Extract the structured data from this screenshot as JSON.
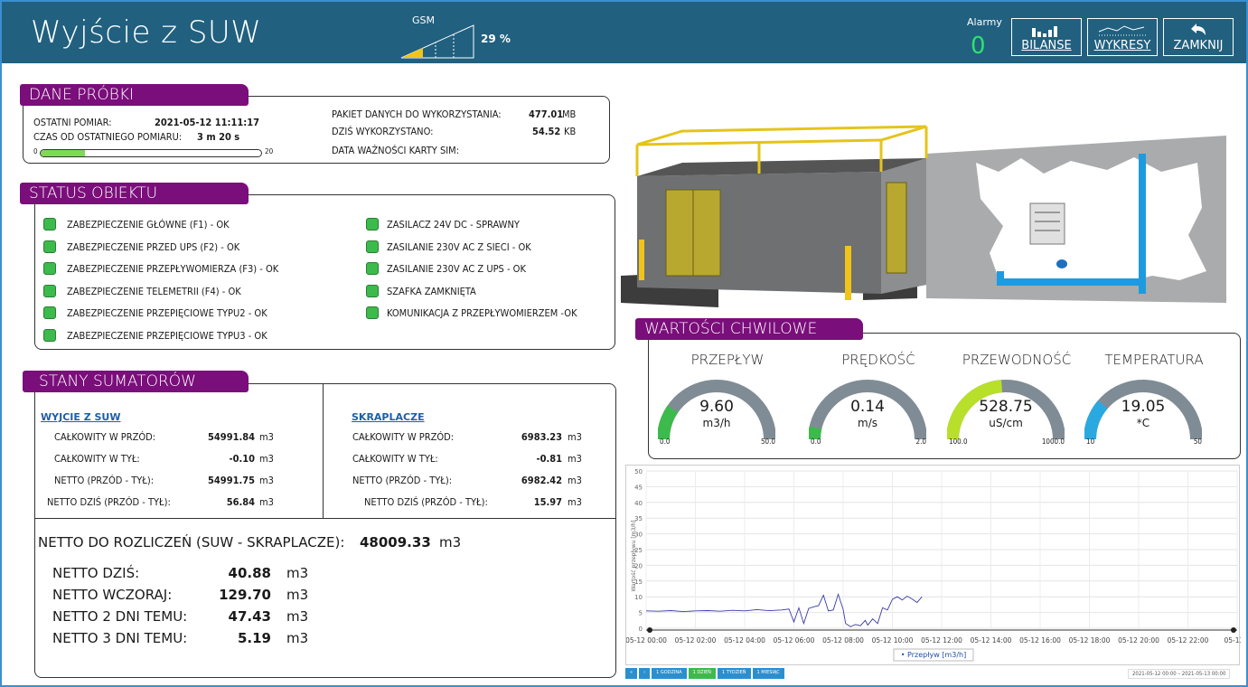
{
  "header": {
    "title": "Wyjście z SUW",
    "gsm_label": "GSM",
    "gsm_percent": "29 %",
    "gsm_level": 0.29,
    "alarm_label": "Alarmy",
    "alarm_count": "0",
    "buttons": {
      "bilanse": "BILANSE",
      "wykresy": "WYKRESY",
      "zamknij": "ZAMKNIJ"
    }
  },
  "dane_probki": {
    "title": "DANE PRÓBKI",
    "ostatni_label": "OSTATNI POMIAR:",
    "ostatni_value": "2021-05-12 11:11:17",
    "czas_label": "CZAS OD OSTATNIEGO POMIARU:",
    "czas_value": "3 m 20 s",
    "progress_min": "0",
    "progress_max": "20",
    "progress_fraction": 0.2,
    "pakiet_label": "PAKIET DANYCH DO WYKORZYSTANIA:",
    "pakiet_value": "477.01",
    "pakiet_unit": "MB",
    "dzis_label": "DZIŚ WYKORZYSTANO:",
    "dzis_value": "54.52",
    "dzis_unit": "KB",
    "sim_label": "DATA WAŻNOŚCI KARTY SIM:"
  },
  "status": {
    "title": "STATUS OBIEKTU",
    "left": [
      "ZABEZPIECZENIE GŁÓWNE (F1) - OK",
      "ZABEZPIECZENIE PRZED UPS (F2) - OK",
      "ZABEZPIECZENIE PRZEPŁYWOMIERZA (F3) - OK",
      "ZABEZPIECZENIE TELEMETRII (F4) - OK",
      "ZABEZPIECZENIE PRZEPIĘCIOWE TYPU2 - OK",
      "ZABEZPIECZENIE PRZEPIĘCIOWE TYPU3 - OK"
    ],
    "right": [
      "ZASILACZ 24V DC - SPRAWNY",
      "ZASILANIE 230V AC Z SIECI - OK",
      "ZASILANIE 230V AC Z UPS - OK",
      "SZAFKA ZAMKNIĘTA",
      "KOMUNIKACJA Z PRZEPŁYWOMIERZEM -OK"
    ]
  },
  "sumatory": {
    "title": "STANY SUMATORÓW",
    "suw_title": "WYJCIE Z SUW",
    "skr_title": "SKRAPLACZE",
    "rows_labels": [
      "CAŁKOWITY W PRZÓD:",
      "CAŁKOWITY W TYŁ:",
      "NETTO (PRZÓD - TYŁ):",
      "NETTO DZIŚ (PRZÓD - TYŁ):"
    ],
    "suw_values": [
      "54991.84",
      "-0.10",
      "54991.75",
      "56.84"
    ],
    "skr_values": [
      "6983.23",
      "-0.81",
      "6982.42",
      "15.97"
    ],
    "unit": "m3",
    "rozliczen_label": "NETTO DO ROZLICZEŃ (SUW - SKRAPLACZE):",
    "rozliczen_value": "48009.33",
    "netto_labels": [
      "NETTO DZIŚ:",
      "NETTO WCZORAJ:",
      "NETTO 2 DNI TEMU:",
      "NETTO 3 DNI TEMU:"
    ],
    "netto_values": [
      "40.88",
      "129.70",
      "47.43",
      "5.19"
    ]
  },
  "chwilowe": {
    "title": "WARTOŚCI CHWILOWE",
    "gauges": [
      {
        "label": "PRZEPŁYW",
        "value": "9.60",
        "unit": "m3/h",
        "min": "0.0",
        "max": "50.0",
        "fraction": 0.192,
        "color": "#3dba4c"
      },
      {
        "label": "PRĘDKOŚĆ",
        "value": "0.14",
        "unit": "m/s",
        "min": "0.0",
        "max": "2.0",
        "fraction": 0.07,
        "color": "#3dba4c"
      },
      {
        "label": "PRZEWODNOŚĆ",
        "value": "528.75",
        "unit": "uS/cm",
        "min": "100.0",
        "max": "1000.0",
        "fraction": 0.476,
        "color": "#b8e02a"
      },
      {
        "label": "TEMPERATURA",
        "value": "19.05",
        "unit": "*C",
        "min": "10",
        "max": "50",
        "fraction": 0.226,
        "color": "#2aa9e0"
      }
    ]
  },
  "chart_data": {
    "type": "line",
    "ylabel": "Wartość przepływu [m3/h]",
    "ylim": [
      0,
      50
    ],
    "yticks": [
      "0",
      "5",
      "10",
      "15",
      "20",
      "25",
      "30",
      "35",
      "40",
      "45",
      "50"
    ],
    "xticks": [
      "05-12 00:00",
      "05-12 02:00",
      "05-12 04:00",
      "05-12 06:00",
      "05-12 08:00",
      "05-12 10:00",
      "05-12 12:00",
      "05-12 14:00",
      "05-12 16:00",
      "05-12 18:00",
      "05-12 20:00",
      "05-12 22:00",
      "05-13 0"
    ],
    "series": [
      {
        "name": "Przepływ [m3/h]",
        "color": "#3a3aa8",
        "x": [
          0,
          0.5,
          1,
          1.5,
          2,
          2.5,
          3,
          3.5,
          4,
          4.5,
          5,
          5.5,
          5.8,
          6.0,
          6.2,
          6.4,
          6.6,
          6.8,
          7.0,
          7.2,
          7.4,
          7.6,
          7.8,
          8.0,
          8.1,
          8.3,
          8.5,
          8.7,
          8.9,
          9.0,
          9.2,
          9.4,
          9.6,
          9.8,
          10.0,
          10.2,
          10.4,
          10.6,
          10.8,
          11.0,
          11.2
        ],
        "values": [
          5.5,
          5.4,
          5.6,
          5.3,
          5.5,
          5.6,
          5.4,
          5.7,
          5.5,
          5.9,
          5.6,
          5.8,
          6.1,
          2,
          6.5,
          1.5,
          6.3,
          6.8,
          7.2,
          10.5,
          5.5,
          5.8,
          10.8,
          6,
          1.5,
          0.5,
          1.2,
          0.8,
          2.5,
          1.0,
          3.0,
          1.5,
          6.5,
          5.8,
          9.2,
          10,
          9.0,
          10.2,
          9.3,
          8.2,
          10.0
        ]
      }
    ]
  },
  "chart_controls": {
    "buttons": [
      "«",
      "‹",
      "1 GODZINA",
      "1 DZIEŃ",
      "1 TYDZIEŃ",
      "1 MIESIĄC"
    ],
    "range": "2021-05-12 00:00 – 2021-05-13 00:00"
  }
}
